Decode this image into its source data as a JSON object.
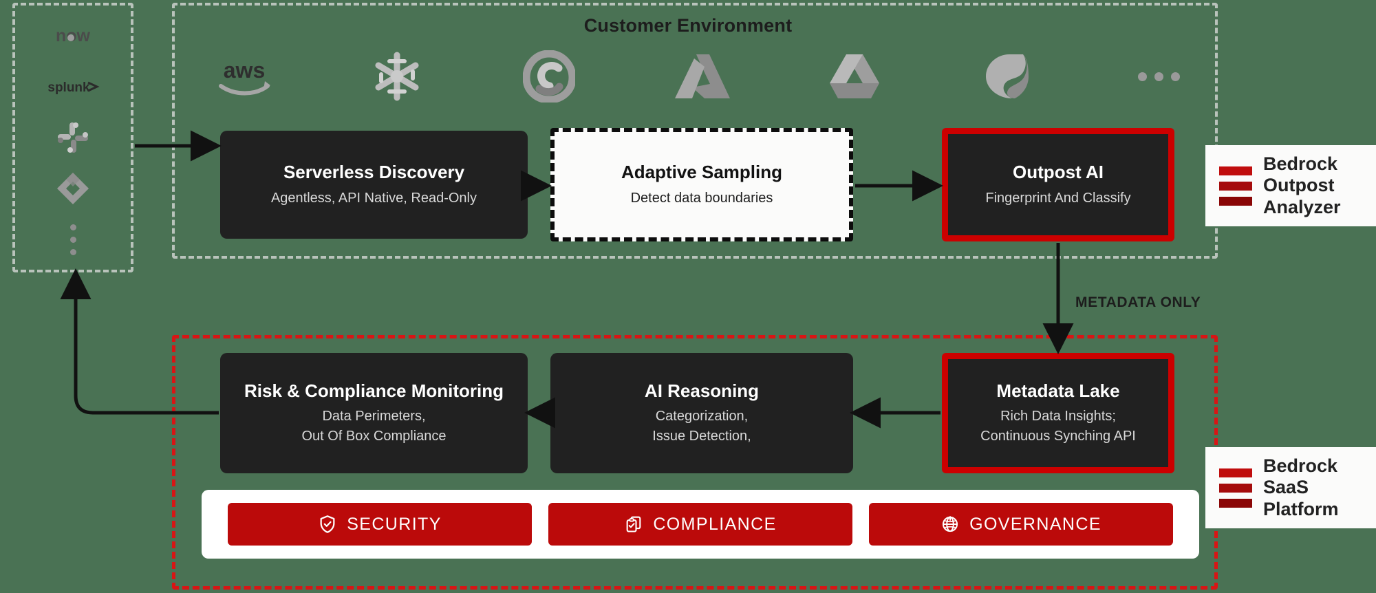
{
  "diagram": {
    "background_color": "#4a7254",
    "accent_red": "#cc0000",
    "pill_red": "#bb0a0a",
    "dark_box": "#212121"
  },
  "sections": {
    "customer_environment": {
      "title": "Customer Environment",
      "border_style": "dashed",
      "border_color": "#b9c3bb"
    },
    "saas_platform": {
      "border_style": "dashed",
      "border_color": "#d81515"
    }
  },
  "source_rail": {
    "logos": [
      {
        "name": "servicenow-logo",
        "label": "now"
      },
      {
        "name": "splunk-logo",
        "label": "splunk>"
      },
      {
        "name": "slack-logo",
        "label": "Slack"
      },
      {
        "name": "jira-logo",
        "label": "Jira"
      },
      {
        "name": "more-sources-dots",
        "label": "..."
      }
    ]
  },
  "cloud_logos": [
    {
      "name": "aws-logo",
      "label": "aws"
    },
    {
      "name": "snowflake-logo",
      "label": "Snowflake"
    },
    {
      "name": "google-cloud-logo",
      "label": "Google Cloud"
    },
    {
      "name": "azure-logo",
      "label": "Microsoft Azure"
    },
    {
      "name": "google-drive-logo",
      "label": "Google Drive"
    },
    {
      "name": "office365-logo",
      "label": "Office 365"
    },
    {
      "name": "more-clouds-dots",
      "label": "..."
    }
  ],
  "flow": {
    "top_row": [
      {
        "id": "serverless-discovery",
        "title": "Serverless Discovery",
        "subtitle_lines": [
          "Agentless, API Native, Read-Only"
        ],
        "style": "dark"
      },
      {
        "id": "adaptive-sampling",
        "title": "Adaptive Sampling",
        "subtitle_lines": [
          "Detect data boundaries"
        ],
        "style": "dashed-light"
      },
      {
        "id": "outpost-ai",
        "title": "Outpost AI",
        "subtitle_lines": [
          "Fingerprint And Classify"
        ],
        "style": "dark-red-frame"
      }
    ],
    "bottom_row": [
      {
        "id": "risk-compliance-monitoring",
        "title": "Risk & Compliance Monitoring",
        "subtitle_lines": [
          "Data Perimeters,",
          "Out Of Box Compliance"
        ],
        "style": "dark"
      },
      {
        "id": "ai-reasoning",
        "title": "AI Reasoning",
        "subtitle_lines": [
          "Categorization,",
          "Issue Detection,"
        ],
        "style": "dark"
      },
      {
        "id": "metadata-lake",
        "title": "Metadata Lake",
        "subtitle_lines": [
          "Rich Data Insights;",
          "Continuous Synching API"
        ],
        "style": "dark-red-frame"
      }
    ],
    "edge_label": "METADATA ONLY"
  },
  "pills": [
    {
      "id": "security",
      "label": "SECURITY",
      "icon": "shield-check-icon"
    },
    {
      "id": "compliance",
      "label": "COMPLIANCE",
      "icon": "clipboard-check-icon"
    },
    {
      "id": "governance",
      "label": "GOVERNANCE",
      "icon": "globe-icon"
    }
  ],
  "legends": [
    {
      "id": "bedrock-outpost-analyzer",
      "lines": [
        "Bedrock",
        "Outpost",
        "Analyzer"
      ],
      "bar_colors": [
        "#c00d0d",
        "#a50c0c",
        "#8a0606"
      ]
    },
    {
      "id": "bedrock-saas-platform",
      "lines": [
        "Bedrock",
        "SaaS",
        "Platform"
      ],
      "bar_colors": [
        "#c00d0d",
        "#a50c0c",
        "#8a0606"
      ]
    }
  ]
}
